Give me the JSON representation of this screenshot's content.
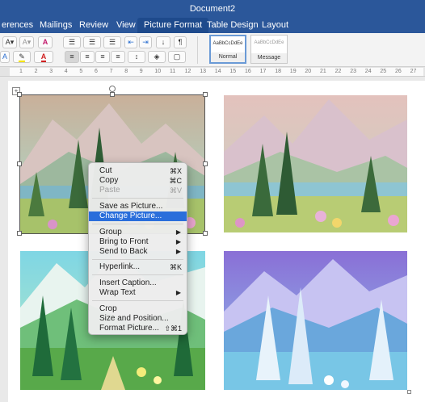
{
  "window": {
    "title": "Document2"
  },
  "tabs": [
    {
      "label": "erences",
      "active": false
    },
    {
      "label": "Mailings",
      "active": false
    },
    {
      "label": "Review",
      "active": false
    },
    {
      "label": "View",
      "active": false
    },
    {
      "label": "Picture Format",
      "active": true
    },
    {
      "label": "Table Design",
      "active": false
    },
    {
      "label": "Layout",
      "active": false
    }
  ],
  "ribbon": {
    "font_size_grow": "A▾",
    "font_size_shrink": "A▾",
    "clear_format": "A",
    "font_color_letter": "A",
    "styles": [
      {
        "preview": "AaBbCcDdEe",
        "name": "Normal",
        "selected": true
      },
      {
        "preview": "AaBbCcDdEe",
        "name": "Message",
        "selected": false
      }
    ]
  },
  "ruler": {
    "numbers": [
      "1",
      "2",
      "3",
      "4",
      "5",
      "6",
      "7",
      "8",
      "9",
      "10",
      "11",
      "12",
      "13",
      "14",
      "15",
      "16",
      "17",
      "18",
      "19",
      "20",
      "21",
      "22",
      "23",
      "24",
      "25",
      "26",
      "27"
    ]
  },
  "context_menu": {
    "items": [
      {
        "label": "Cut",
        "shortcut": "⌘X",
        "state": "normal"
      },
      {
        "label": "Copy",
        "shortcut": "⌘C",
        "state": "normal"
      },
      {
        "label": "Paste",
        "shortcut": "⌘V",
        "state": "disabled"
      },
      {
        "label": "Save as Picture...",
        "shortcut": "",
        "state": "normal"
      },
      {
        "label": "Change Picture...",
        "shortcut": "",
        "state": "highlighted"
      },
      {
        "label": "Group",
        "shortcut": "▶",
        "state": "submenu"
      },
      {
        "label": "Bring to Front",
        "shortcut": "▶",
        "state": "submenu"
      },
      {
        "label": "Send to Back",
        "shortcut": "▶",
        "state": "submenu"
      },
      {
        "label": "Hyperlink...",
        "shortcut": "⌘K",
        "state": "normal"
      },
      {
        "label": "Insert Caption...",
        "shortcut": "",
        "state": "normal"
      },
      {
        "label": "Wrap Text",
        "shortcut": "▶",
        "state": "submenu"
      },
      {
        "label": "Crop",
        "shortcut": "",
        "state": "normal"
      },
      {
        "label": "Size and Position...",
        "shortcut": "",
        "state": "normal"
      },
      {
        "label": "Format Picture...",
        "shortcut": "⇧⌘1",
        "state": "normal"
      }
    ]
  },
  "colors": {
    "ribbon_blue": "#2b579a",
    "menu_highlight": "#2a6edb"
  }
}
